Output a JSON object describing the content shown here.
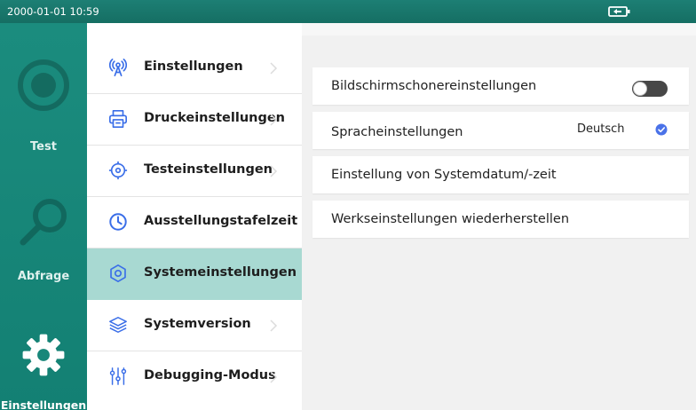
{
  "statusbar": {
    "datetime": "2000-01-01 10:59",
    "battery_icon": "battery-charging-icon"
  },
  "leftnav": {
    "items": [
      {
        "label": "Test",
        "icon": "test-circle-icon",
        "active": false
      },
      {
        "label": "Abfrage",
        "icon": "search-icon",
        "active": false
      },
      {
        "label": "Einstellungen",
        "icon": "gear-icon",
        "active": true
      }
    ]
  },
  "menu": {
    "items": [
      {
        "label": "Einstellungen",
        "icon": "wireless-tower-icon",
        "active": false,
        "chevron": true
      },
      {
        "label": "Druckeinstellungen",
        "icon": "printer-icon",
        "active": false,
        "chevron": true
      },
      {
        "label": "Testeinstellungen",
        "icon": "target-icon",
        "active": false,
        "chevron": true
      },
      {
        "label": "Ausstellungstafelzeit",
        "icon": "clock-icon",
        "active": false,
        "chevron": false
      },
      {
        "label": "Systemeinstellungen",
        "icon": "gear-icon",
        "active": true,
        "chevron": false
      },
      {
        "label": "Systemversion",
        "icon": "layers-icon",
        "active": false,
        "chevron": true
      },
      {
        "label": "Debugging-Modus",
        "icon": "sliders-icon",
        "active": false,
        "chevron": true
      }
    ]
  },
  "content": {
    "cards": [
      {
        "label": "Bildschirmschonereinstellungen",
        "control": "toggle",
        "toggle_on": false
      },
      {
        "label": "Spracheinstellungen",
        "control": "select",
        "value": "Deutsch"
      },
      {
        "label": "Einstellung von Systemdatum/-zeit",
        "control": "none"
      },
      {
        "label": "Werkseinstellungen wiederherstellen",
        "control": "none"
      }
    ]
  },
  "colors": {
    "accent": "#1b8c7e",
    "menu_active": "#a8d9d2",
    "check_blue": "#4a72e8",
    "toggle_off": "#474747"
  }
}
